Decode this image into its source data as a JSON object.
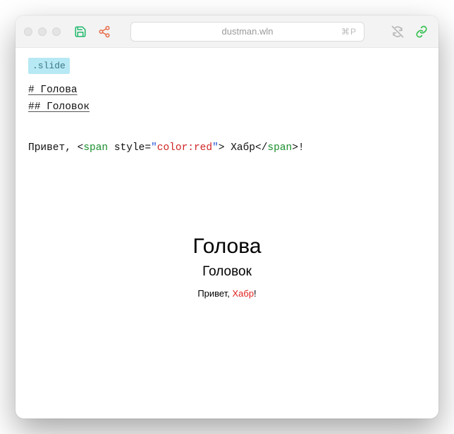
{
  "titlebar": {
    "filename": "dustman.wln",
    "shortcut": "⌘P"
  },
  "editor": {
    "slide_tag": ".slide",
    "h1_src": "# Голова",
    "h2_src": "## Головок",
    "code": {
      "prefix": "Привет, <",
      "tag_open": "span",
      "attr_key": " style=",
      "q1": "\"",
      "attr_val": "color:red",
      "q2": "\"",
      "gt": "> Хабр</",
      "tag_close": "span",
      "suffix": ">!"
    }
  },
  "preview": {
    "h1": "Голова",
    "h2": "Головок",
    "greet_before": "Привет, ",
    "greet_red": "Хабр",
    "greet_after": "!"
  }
}
